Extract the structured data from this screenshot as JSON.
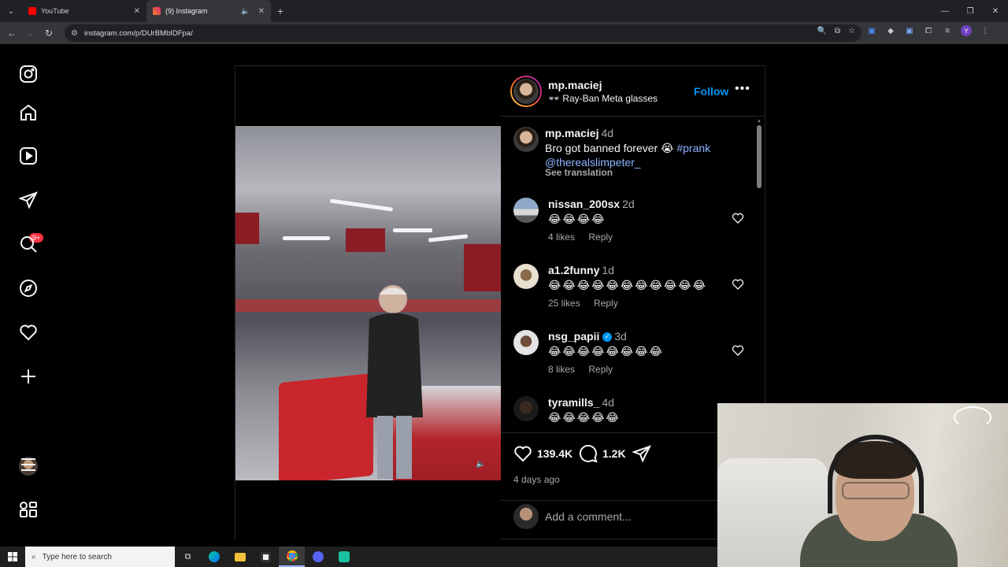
{
  "browser": {
    "tabs": [
      {
        "title": "YouTube",
        "active": false,
        "favicon_color": "#ff0000"
      },
      {
        "title": "(9) Instagram",
        "active": true,
        "favicon_color": "#d62976"
      }
    ],
    "url": "instagram.com/p/DUrBMbIDFpa/",
    "profile_initial": "Y"
  },
  "sidebar": {
    "items": [
      "instagram-logo",
      "home",
      "reels",
      "direct-messages",
      "search",
      "explore",
      "notifications",
      "create",
      "profile",
      "more",
      "also-from-meta"
    ],
    "messages_badge": "9+"
  },
  "post": {
    "author": "mp.maciej",
    "subtitle": "👓 Ray-Ban Meta glasses",
    "follow_label": "Follow",
    "more_label": "•••",
    "caption": {
      "user": "mp.maciej",
      "time": "4d",
      "text": "Bro got banned forever 😭",
      "hashtag": "#prank",
      "mention": "@therealslimpeter_",
      "see_translation": "See translation"
    },
    "comments": [
      {
        "user": "nissan_200sx",
        "time": "2d",
        "text": "😂😂😂😂",
        "likes": "4 likes",
        "reply": "Reply",
        "verified": false
      },
      {
        "user": "a1.2funny",
        "time": "1d",
        "text": "😂😂😂😂😂😂😂😂😂😂😂",
        "likes": "25 likes",
        "reply": "Reply",
        "verified": false
      },
      {
        "user": "nsg_papii",
        "time": "3d",
        "text": "😂😂😂😂😂😂😂😂",
        "likes": "8 likes",
        "reply": "Reply",
        "verified": true
      },
      {
        "user": "tyramills_",
        "time": "4d",
        "text": "😂😂😂😂😂",
        "likes": "",
        "reply": "",
        "verified": false
      }
    ],
    "like_count": "139.4K",
    "comment_count": "1.2K",
    "date": "4 days ago",
    "add_comment_placeholder": "Add a comment..."
  },
  "taskbar": {
    "search_placeholder": "Type here to search",
    "apps": [
      "task-view",
      "edge",
      "file-explorer",
      "store",
      "chrome",
      "discord-like",
      "app"
    ]
  },
  "colors": {
    "accent": "#0095f6",
    "badge": "#ff3040",
    "background": "#000000"
  }
}
